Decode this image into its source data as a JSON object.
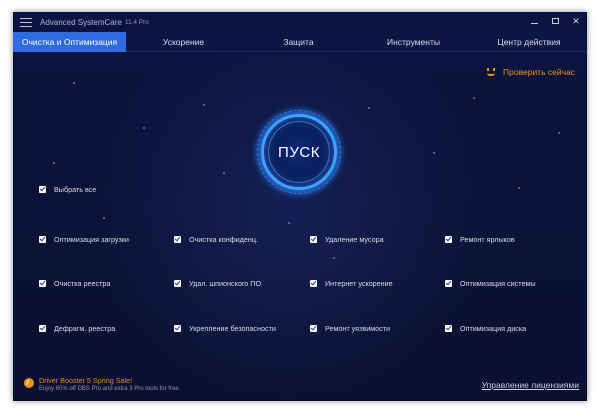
{
  "app": {
    "title": "Advanced SystemCare",
    "version": "11.4 Pro"
  },
  "tabs": [
    {
      "label": "Очистка и Оптимизация",
      "active": true
    },
    {
      "label": "Ускорение",
      "active": false
    },
    {
      "label": "Защита",
      "active": false
    },
    {
      "label": "Инструменты",
      "active": false
    },
    {
      "label": "Центр действия",
      "active": false
    }
  ],
  "check_now": {
    "label": "Проверить сейчас",
    "icon": "smile-icon"
  },
  "scan_button": {
    "label": "ПУСК"
  },
  "select_all": {
    "label": "Выбрать все",
    "checked": true
  },
  "options": {
    "row1": [
      "Оптимизация загрузки",
      "Очистка конфиденц.",
      "Удаление мусора",
      "Ремонт ярлыков"
    ],
    "row2": [
      "Очистка реестра",
      "Удал. шпионского ПО",
      "Интернет ускорение",
      "Оптимизация системы"
    ],
    "row3": [
      "Дефрагм. реестра",
      "Укрепление безопасности",
      "Ремонт уязвимости",
      "Оптимизация диска"
    ]
  },
  "promo": {
    "title": "Driver Booster 5 Spring Sale!",
    "subtitle": "Enjoy 60% off DBS Pro and extra 3 Pro tools for free."
  },
  "license_link": "Управление лицензиями",
  "colors": {
    "background": "#0a1236",
    "active_tab": "#2e6be0",
    "accent_orange": "#f0921c",
    "ring_blue": "#3ea2ff"
  }
}
